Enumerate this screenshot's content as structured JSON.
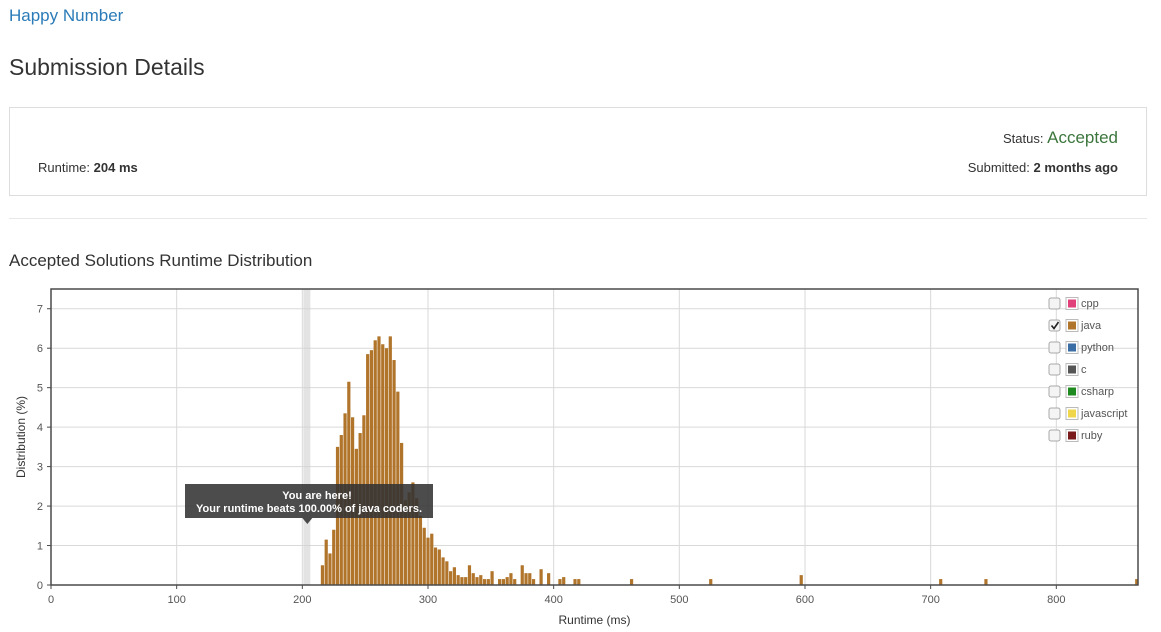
{
  "problem": {
    "title": "Happy Number"
  },
  "page_title": "Submission Details",
  "details": {
    "runtime_label": "Runtime:",
    "runtime_value": "204 ms",
    "status_label": "Status:",
    "status_value": "Accepted",
    "submitted_label": "Submitted:",
    "submitted_value": "2 months ago"
  },
  "colors": {
    "accent_link": "#2a7bb8",
    "accepted": "#3c763d",
    "java_bar": "#b0742a"
  },
  "tooltip": {
    "line1": "You are here!",
    "line2": "Your runtime beats 100.00% of java coders."
  },
  "legend": [
    {
      "name": "cpp",
      "color": "#e0417b",
      "checked": false
    },
    {
      "name": "java",
      "color": "#b0742a",
      "checked": true
    },
    {
      "name": "python",
      "color": "#3a6ea5",
      "checked": false
    },
    {
      "name": "c",
      "color": "#555555",
      "checked": false
    },
    {
      "name": "csharp",
      "color": "#1f8a1f",
      "checked": false
    },
    {
      "name": "javascript",
      "color": "#f0d64a",
      "checked": false
    },
    {
      "name": "ruby",
      "color": "#7a1a1a",
      "checked": false
    }
  ],
  "chart_data": {
    "type": "bar",
    "title": "Accepted Solutions Runtime Distribution",
    "xlabel": "Runtime (ms)",
    "ylabel": "Distribution (%)",
    "xlim": [
      0,
      865
    ],
    "ylim": [
      0,
      7.5
    ],
    "x_ticks": [
      0,
      100,
      200,
      300,
      400,
      500,
      600,
      700,
      800
    ],
    "y_ticks": [
      0,
      1,
      2,
      3,
      4,
      5,
      6,
      7
    ],
    "grid": true,
    "legend_position": "top-right",
    "highlight_runtime": 204,
    "series": [
      {
        "name": "java",
        "x": [
          216,
          219,
          222,
          225,
          228,
          231,
          234,
          237,
          240,
          243,
          246,
          249,
          252,
          255,
          258,
          261,
          264,
          267,
          270,
          273,
          276,
          279,
          282,
          285,
          288,
          291,
          294,
          297,
          300,
          303,
          306,
          309,
          312,
          315,
          318,
          321,
          324,
          327,
          330,
          333,
          336,
          339,
          342,
          345,
          348,
          351,
          357,
          360,
          363,
          366,
          369,
          375,
          378,
          381,
          384,
          390,
          396,
          405,
          408,
          417,
          420,
          462,
          525,
          597,
          708,
          744,
          864
        ],
        "y": [
          0.5,
          1.15,
          0.8,
          1.4,
          3.5,
          3.8,
          4.35,
          5.15,
          4.25,
          3.45,
          3.85,
          4.3,
          5.85,
          5.95,
          6.2,
          6.3,
          6.1,
          6.0,
          6.3,
          5.7,
          4.9,
          3.6,
          2.15,
          2.35,
          2.6,
          2.2,
          1.75,
          1.45,
          1.2,
          1.3,
          0.95,
          0.9,
          0.7,
          0.6,
          0.35,
          0.45,
          0.25,
          0.2,
          0.2,
          0.5,
          0.3,
          0.2,
          0.25,
          0.15,
          0.15,
          0.35,
          0.15,
          0.15,
          0.2,
          0.3,
          0.15,
          0.5,
          0.3,
          0.3,
          0.15,
          0.4,
          0.3,
          0.15,
          0.2,
          0.15,
          0.15,
          0.15,
          0.15,
          0.25,
          0.15,
          0.15,
          0.15
        ]
      }
    ]
  }
}
